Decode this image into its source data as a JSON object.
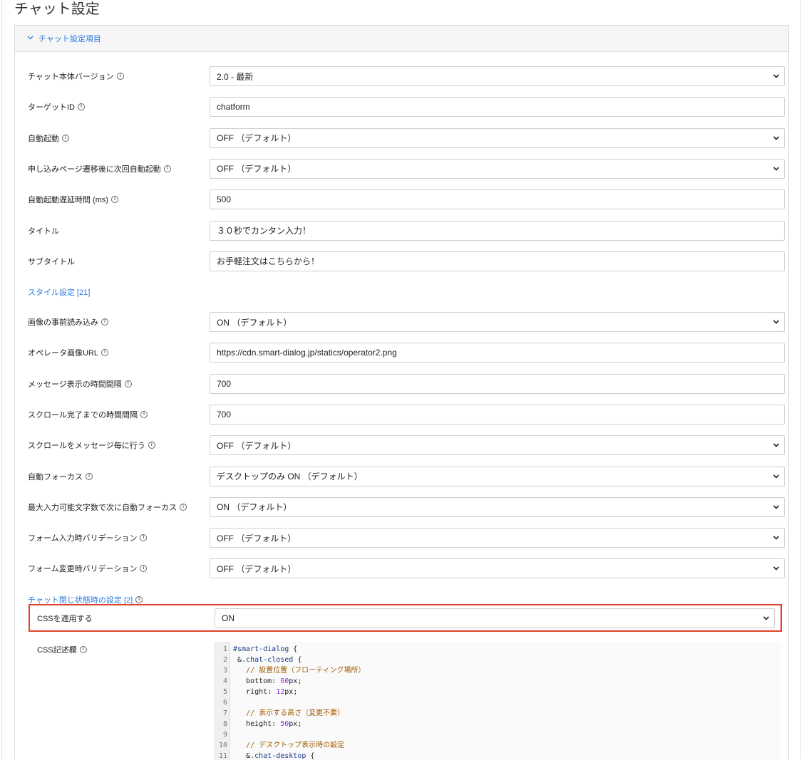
{
  "page_title": "チャット設定",
  "panel": {
    "header_label": "チャット設定項目"
  },
  "rows": [
    {
      "label": "チャット本体バージョン",
      "value": "2.0 - 最新",
      "type": "select"
    },
    {
      "label": "ターゲットID",
      "value": "chatform",
      "type": "input"
    },
    {
      "label": "自動起動",
      "value": "OFF （デフォルト）",
      "type": "select"
    },
    {
      "label": "申し込みページ遷移後に次回自動起動",
      "value": "OFF （デフォルト）",
      "type": "select"
    },
    {
      "label": "自動起動遅延時間 (ms)",
      "value": "500",
      "type": "input"
    },
    {
      "label": "タイトル",
      "value": "３０秒でカンタン入力！",
      "type": "input"
    },
    {
      "label": "サブタイトル",
      "value": "お手軽注文はこちらから！",
      "type": "input"
    }
  ],
  "style_section_link": "スタイル設定 [21]",
  "style_rows": [
    {
      "label": "画像の事前読み込み",
      "value": "ON （デフォルト）",
      "type": "select"
    },
    {
      "label": "オペレータ画像URL",
      "value": "https://cdn.smart-dialog.jp/statics/operator2.png",
      "type": "input"
    },
    {
      "label": "メッセージ表示の時間間隔",
      "value": "700",
      "type": "input"
    },
    {
      "label": "スクロール完了までの時間間隔",
      "value": "700",
      "type": "input"
    },
    {
      "label": "スクロールをメッセージ毎に行う",
      "value": "OFF （デフォルト）",
      "type": "select"
    },
    {
      "label": "自動フォーカス",
      "value": "デスクトップのみ ON （デフォルト）",
      "type": "select"
    },
    {
      "label": "最大入力可能文字数で次に自動フォーカス",
      "value": "ON （デフォルト）",
      "type": "select"
    },
    {
      "label": "フォーム入力時バリデーション",
      "value": "OFF （デフォルト）",
      "type": "select"
    },
    {
      "label": "フォーム変更時バリデーション",
      "value": "OFF （デフォルト）",
      "type": "select"
    }
  ],
  "closed_section_link": "チャット閉じ状態時の設定 [2]",
  "css_apply": {
    "label": "CSSを適用する",
    "value": "ON"
  },
  "css_editor": {
    "label": "CSS記述欄",
    "lines": [
      {
        "n": "1",
        "text": "#smart-dialog {"
      },
      {
        "n": "2",
        "text": " &.chat-closed {"
      },
      {
        "n": "3",
        "text": "   // 設置位置（フローティング場所）"
      },
      {
        "n": "4",
        "text": "   bottom: 60px;"
      },
      {
        "n": "5",
        "text": "   right: 12px;"
      },
      {
        "n": "6",
        "text": ""
      },
      {
        "n": "7",
        "text": "   // 表示する高さ（変更不要）"
      },
      {
        "n": "8",
        "text": "   height: 50px;"
      },
      {
        "n": "9",
        "text": ""
      },
      {
        "n": "10",
        "text": "   // デスクトップ表示時の設定"
      },
      {
        "n": "11",
        "text": "   &.chat-desktop {"
      }
    ]
  },
  "colors": {
    "link": "#2a7ae2",
    "highlight": "#e0412a"
  },
  "icons": {
    "info": "info-icon",
    "chevron": "chevron-down-icon",
    "select_caret": "select-caret-icon"
  }
}
